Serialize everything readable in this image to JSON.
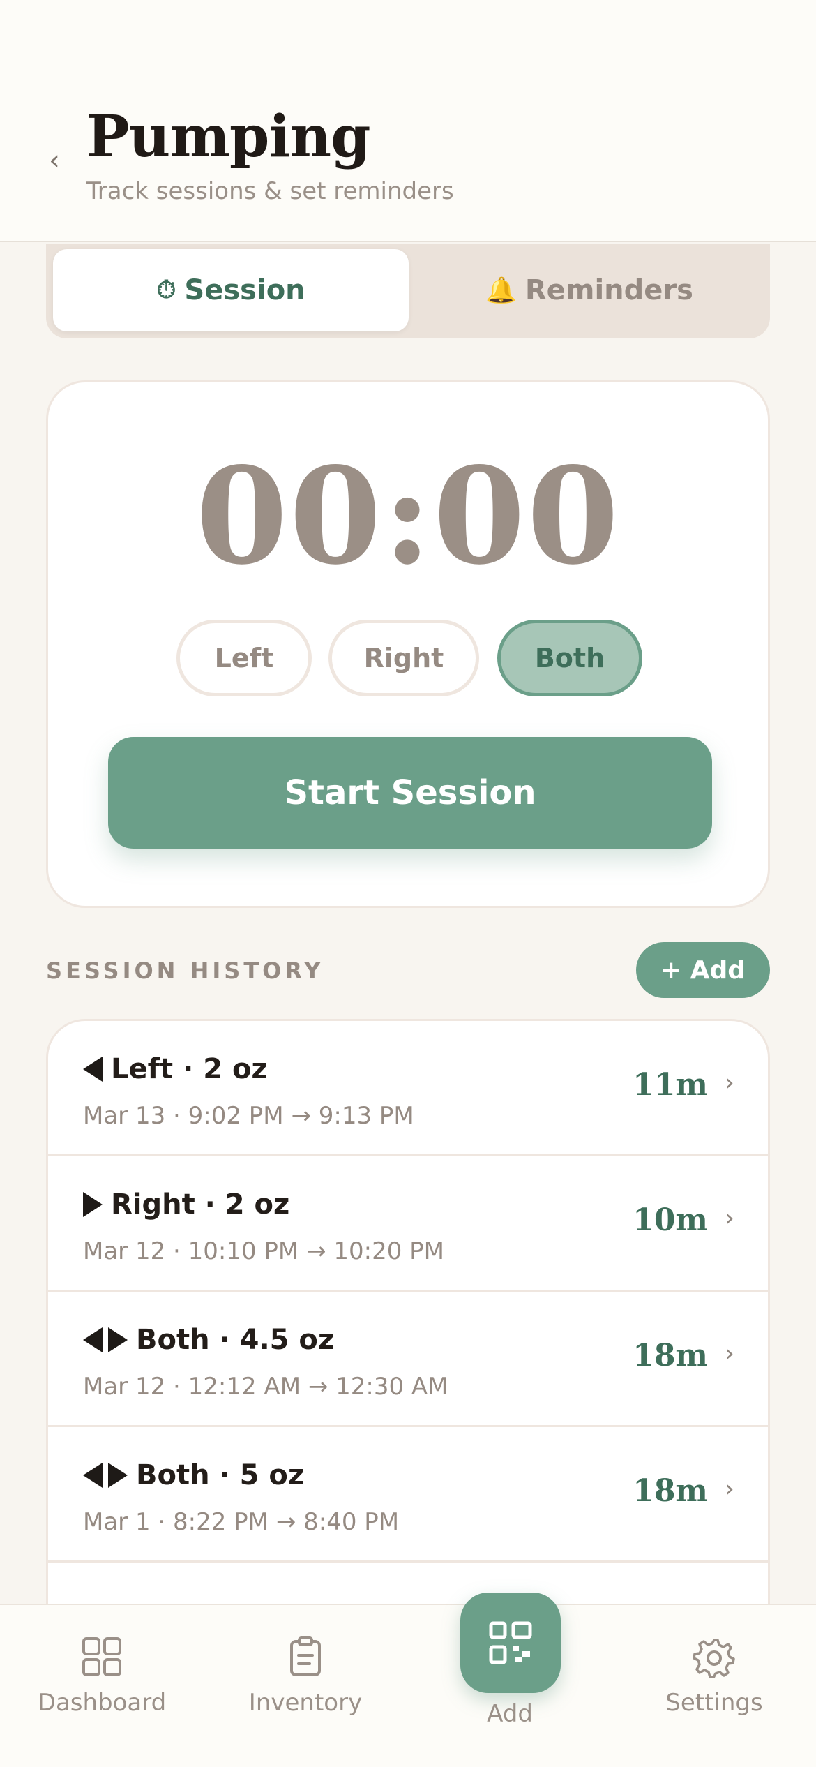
{
  "header": {
    "title": "Pumping",
    "subtitle": "Track sessions & set reminders",
    "back_glyph": "‹"
  },
  "tabs": [
    {
      "label": "Session",
      "icon": "⏱",
      "active": true
    },
    {
      "label": "Reminders",
      "icon": "🔔",
      "active": false
    }
  ],
  "timer": {
    "value": "00:00",
    "sides": [
      {
        "label": "Left",
        "selected": false
      },
      {
        "label": "Right",
        "selected": false
      },
      {
        "label": "Both",
        "selected": true
      }
    ],
    "start_label": "Start Session"
  },
  "history": {
    "title": "SESSION HISTORY",
    "add_label": "+ Add",
    "sessions": [
      {
        "side": "left",
        "title": "Left · 2 oz",
        "time": "Mar 13 · 9:02 PM → 9:13 PM",
        "duration": "11m"
      },
      {
        "side": "right",
        "title": "Right · 2 oz",
        "time": "Mar 12 · 10:10 PM → 10:20 PM",
        "duration": "10m"
      },
      {
        "side": "both",
        "title": "Both · 4.5 oz",
        "time": "Mar 12 · 12:12 AM → 12:30 AM",
        "duration": "18m"
      },
      {
        "side": "both",
        "title": "Both · 5 oz",
        "time": "Mar 1 · 8:22 PM → 8:40 PM",
        "duration": "18m"
      }
    ],
    "chevron": "›"
  },
  "tabbar": {
    "dashboard": "Dashboard",
    "inventory": "Inventory",
    "add": "Add",
    "settings": "Settings"
  },
  "colors": {
    "accent": "#6b9f89",
    "accent_dark": "#3e6e5a",
    "background": "#f8f5f0",
    "muted": "#958a82"
  }
}
